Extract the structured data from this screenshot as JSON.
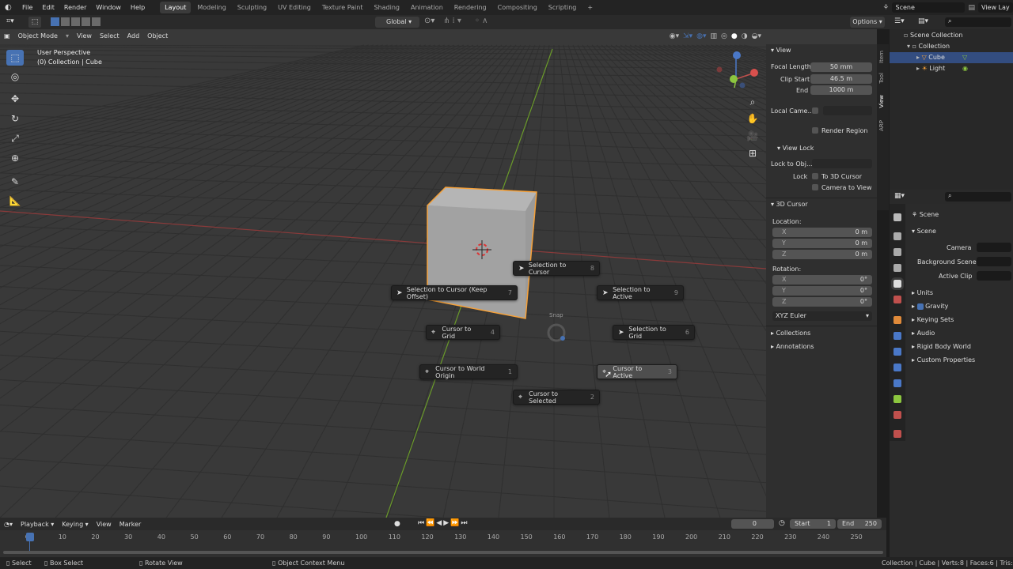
{
  "menu": [
    "File",
    "Edit",
    "Render",
    "Window",
    "Help"
  ],
  "workspaces": [
    "Layout",
    "Modeling",
    "Sculpting",
    "UV Editing",
    "Texture Paint",
    "Shading",
    "Animation",
    "Rendering",
    "Compositing",
    "Scripting"
  ],
  "active_workspace": "Layout",
  "scene_name": "Scene",
  "view_layer": "View Lay",
  "transform_orientation": "Global",
  "options_label": "Options",
  "viewport_header": {
    "mode": "Object Mode",
    "items": [
      "View",
      "Select",
      "Add",
      "Object"
    ]
  },
  "viewport_info": {
    "line1": "User Perspective",
    "line2": "(0) Collection | Cube"
  },
  "npanel": {
    "view_title": "View",
    "focal_length_label": "Focal Length",
    "focal_length": "50 mm",
    "clip_start_label": "Clip Start",
    "clip_start": "46.5 m",
    "end_label": "End",
    "end": "1000 m",
    "local_camera_label": "Local Came...",
    "render_region_label": "Render Region",
    "view_lock_title": "View Lock",
    "lock_to_obj_label": "Lock to Obj...",
    "lock_label": "Lock",
    "to_3d_cursor_label": "To 3D Cursor",
    "camera_to_view_label": "Camera to View",
    "cursor_title": "3D Cursor",
    "location_label": "Location:",
    "rotation_label": "Rotation:",
    "loc": [
      {
        "axis": "X",
        "value": "0 m"
      },
      {
        "axis": "Y",
        "value": "0 m"
      },
      {
        "axis": "Z",
        "value": "0 m"
      }
    ],
    "rot": [
      {
        "axis": "X",
        "value": "0°"
      },
      {
        "axis": "Y",
        "value": "0°"
      },
      {
        "axis": "Z",
        "value": "0°"
      }
    ],
    "rotation_mode": "XYZ Euler",
    "collections_label": "Collections",
    "annotations_label": "Annotations",
    "tabs": [
      "Item",
      "Tool",
      "View",
      "ARP"
    ]
  },
  "outliner": {
    "scene_collection": "Scene Collection",
    "collection": "Collection",
    "cube": "Cube",
    "light": "Light"
  },
  "properties": {
    "scene_title": "Scene",
    "scene_section": "Scene",
    "camera_label": "Camera",
    "background_scene_label": "Background Scene",
    "active_clip_label": "Active Clip",
    "units_label": "Units",
    "gravity_label": "Gravity",
    "keying_sets_label": "Keying Sets",
    "audio_label": "Audio",
    "rigid_body_world_label": "Rigid Body World",
    "custom_properties_label": "Custom Properties"
  },
  "pie_menu": {
    "title": "Snap",
    "items": [
      {
        "label": "Selection to Cursor",
        "key": "8"
      },
      {
        "label": "Selection to Cursor (Keep Offset)",
        "key": "7"
      },
      {
        "label": "Selection to Active",
        "key": "9"
      },
      {
        "label": "Cursor to Grid",
        "key": "4"
      },
      {
        "label": "Selection to Grid",
        "key": "6"
      },
      {
        "label": "Cursor to World Origin",
        "key": "1"
      },
      {
        "label": "Cursor to Active",
        "key": "3"
      },
      {
        "label": "Cursor to Selected",
        "key": "2"
      }
    ]
  },
  "timeline": {
    "menus": [
      "Playback",
      "Keying",
      "View",
      "Marker"
    ],
    "current_frame": "0",
    "start_label": "Start",
    "start": "1",
    "end_label": "End",
    "end": "250",
    "ruler": [
      "0",
      "10",
      "20",
      "30",
      "40",
      "50",
      "60",
      "70",
      "80",
      "90",
      "100",
      "110",
      "120",
      "130",
      "140",
      "150",
      "160",
      "170",
      "180",
      "190",
      "200",
      "210",
      "220",
      "230",
      "240",
      "250"
    ]
  },
  "statusbar": {
    "select": "Select",
    "box_select": "Box Select",
    "rotate_view": "Rotate View",
    "context_menu": "Object Context Menu",
    "stats": "Collection | Cube | Verts:8 | Faces:6 | Tris:12 | Ob"
  },
  "colors": {
    "accent": "#4772b3",
    "selection": "#f5a13a",
    "x_axis": "#c0504d",
    "y_axis": "#8cc63f"
  }
}
